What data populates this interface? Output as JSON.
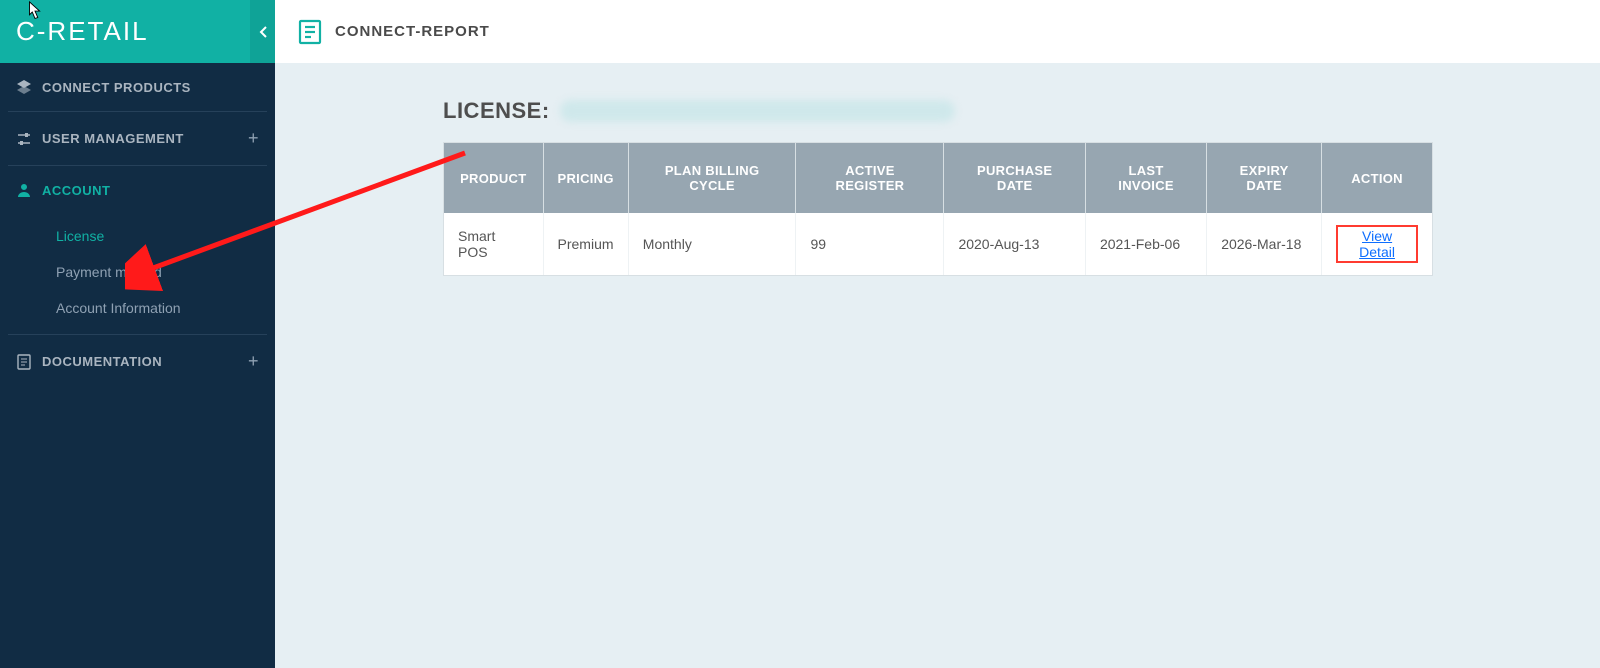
{
  "brand": "C-RETAIL",
  "topbar": {
    "title": "CONNECT-REPORT"
  },
  "sidebar": {
    "items": [
      {
        "label": "CONNECT PRODUCTS",
        "icon": "layers"
      },
      {
        "label": "USER MANAGEMENT",
        "icon": "sliders",
        "expandable": true
      },
      {
        "label": "ACCOUNT",
        "icon": "user",
        "active": true,
        "children": [
          {
            "label": "License",
            "active": true
          },
          {
            "label": "Payment method"
          },
          {
            "label": "Account Information"
          }
        ]
      },
      {
        "label": "DOCUMENTATION",
        "icon": "doc",
        "expandable": true
      }
    ]
  },
  "page": {
    "heading": "LICENSE:"
  },
  "table": {
    "headers": [
      "PRODUCT",
      "PRICING",
      "PLAN BILLING CYCLE",
      "ACTIVE REGISTER",
      "PURCHASE DATE",
      "LAST INVOICE",
      "EXPIRY DATE",
      "ACTION"
    ],
    "rows": [
      {
        "product": "Smart POS",
        "pricing": "Premium",
        "cycle": "Monthly",
        "active_register": "99",
        "purchase": "2020-Aug-13",
        "last_invoice": "2021-Feb-06",
        "expiry": "2026-Mar-18",
        "action_label": "View Detail"
      }
    ]
  }
}
